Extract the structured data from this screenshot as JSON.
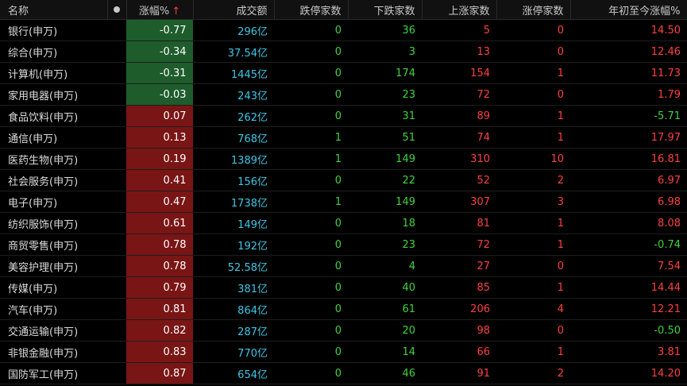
{
  "header": {
    "name": "名称",
    "change_pct": "涨幅%",
    "sort_arrow": "↑",
    "volume": "成交额",
    "limit_down": "跌停家数",
    "falling": "下跌家数",
    "rising": "上涨家数",
    "limit_up": "涨停家数",
    "ytd": "年初至今涨幅%"
  },
  "rows": [
    {
      "name": "银行(申万)",
      "change": "-0.77",
      "volume": "296亿",
      "limit_down": "0",
      "falling": "36",
      "rising": "5",
      "limit_up": "0",
      "ytd": "14.50"
    },
    {
      "name": "综合(申万)",
      "change": "-0.34",
      "volume": "37.54亿",
      "limit_down": "0",
      "falling": "3",
      "rising": "13",
      "limit_up": "0",
      "ytd": "12.46"
    },
    {
      "name": "计算机(申万)",
      "change": "-0.31",
      "volume": "1445亿",
      "limit_down": "0",
      "falling": "174",
      "rising": "154",
      "limit_up": "1",
      "ytd": "11.73"
    },
    {
      "name": "家用电器(申万)",
      "change": "-0.03",
      "volume": "243亿",
      "limit_down": "0",
      "falling": "23",
      "rising": "72",
      "limit_up": "0",
      "ytd": "1.79"
    },
    {
      "name": "食品饮料(申万)",
      "change": "0.07",
      "volume": "262亿",
      "limit_down": "0",
      "falling": "31",
      "rising": "89",
      "limit_up": "1",
      "ytd": "-5.71"
    },
    {
      "name": "通信(申万)",
      "change": "0.13",
      "volume": "768亿",
      "limit_down": "1",
      "falling": "51",
      "rising": "74",
      "limit_up": "1",
      "ytd": "17.97"
    },
    {
      "name": "医药生物(申万)",
      "change": "0.19",
      "volume": "1389亿",
      "limit_down": "1",
      "falling": "149",
      "rising": "310",
      "limit_up": "10",
      "ytd": "16.81"
    },
    {
      "name": "社会服务(申万)",
      "change": "0.41",
      "volume": "156亿",
      "limit_down": "0",
      "falling": "22",
      "rising": "52",
      "limit_up": "2",
      "ytd": "6.97"
    },
    {
      "name": "电子(申万)",
      "change": "0.47",
      "volume": "1738亿",
      "limit_down": "1",
      "falling": "149",
      "rising": "307",
      "limit_up": "3",
      "ytd": "6.98"
    },
    {
      "name": "纺织服饰(申万)",
      "change": "0.61",
      "volume": "149亿",
      "limit_down": "0",
      "falling": "18",
      "rising": "81",
      "limit_up": "1",
      "ytd": "8.08"
    },
    {
      "name": "商贸零售(申万)",
      "change": "0.78",
      "volume": "192亿",
      "limit_down": "0",
      "falling": "23",
      "rising": "72",
      "limit_up": "1",
      "ytd": "-0.74"
    },
    {
      "name": "美容护理(申万)",
      "change": "0.78",
      "volume": "52.58亿",
      "limit_down": "0",
      "falling": "4",
      "rising": "27",
      "limit_up": "0",
      "ytd": "7.54"
    },
    {
      "name": "传媒(申万)",
      "change": "0.79",
      "volume": "381亿",
      "limit_down": "0",
      "falling": "40",
      "rising": "85",
      "limit_up": "1",
      "ytd": "14.44"
    },
    {
      "name": "汽车(申万)",
      "change": "0.81",
      "volume": "864亿",
      "limit_down": "0",
      "falling": "61",
      "rising": "206",
      "limit_up": "4",
      "ytd": "12.21"
    },
    {
      "name": "交通运输(申万)",
      "change": "0.82",
      "volume": "287亿",
      "limit_down": "0",
      "falling": "20",
      "rising": "98",
      "limit_up": "0",
      "ytd": "-0.50"
    },
    {
      "name": "非银金融(申万)",
      "change": "0.83",
      "volume": "770亿",
      "limit_down": "0",
      "falling": "14",
      "rising": "66",
      "limit_up": "1",
      "ytd": "3.81"
    },
    {
      "name": "国防军工(申万)",
      "change": "0.87",
      "volume": "654亿",
      "limit_down": "0",
      "falling": "46",
      "rising": "91",
      "limit_up": "2",
      "ytd": "14.20"
    }
  ],
  "icons": {
    "dot": "dot-icon",
    "sort": "arrow-up-icon"
  },
  "colors": {
    "negative_bg": "#1e5c2c",
    "positive_bg": "#7a1515",
    "volume": "#3ec8e6",
    "green": "#3fd33f",
    "red": "#ff4040"
  }
}
